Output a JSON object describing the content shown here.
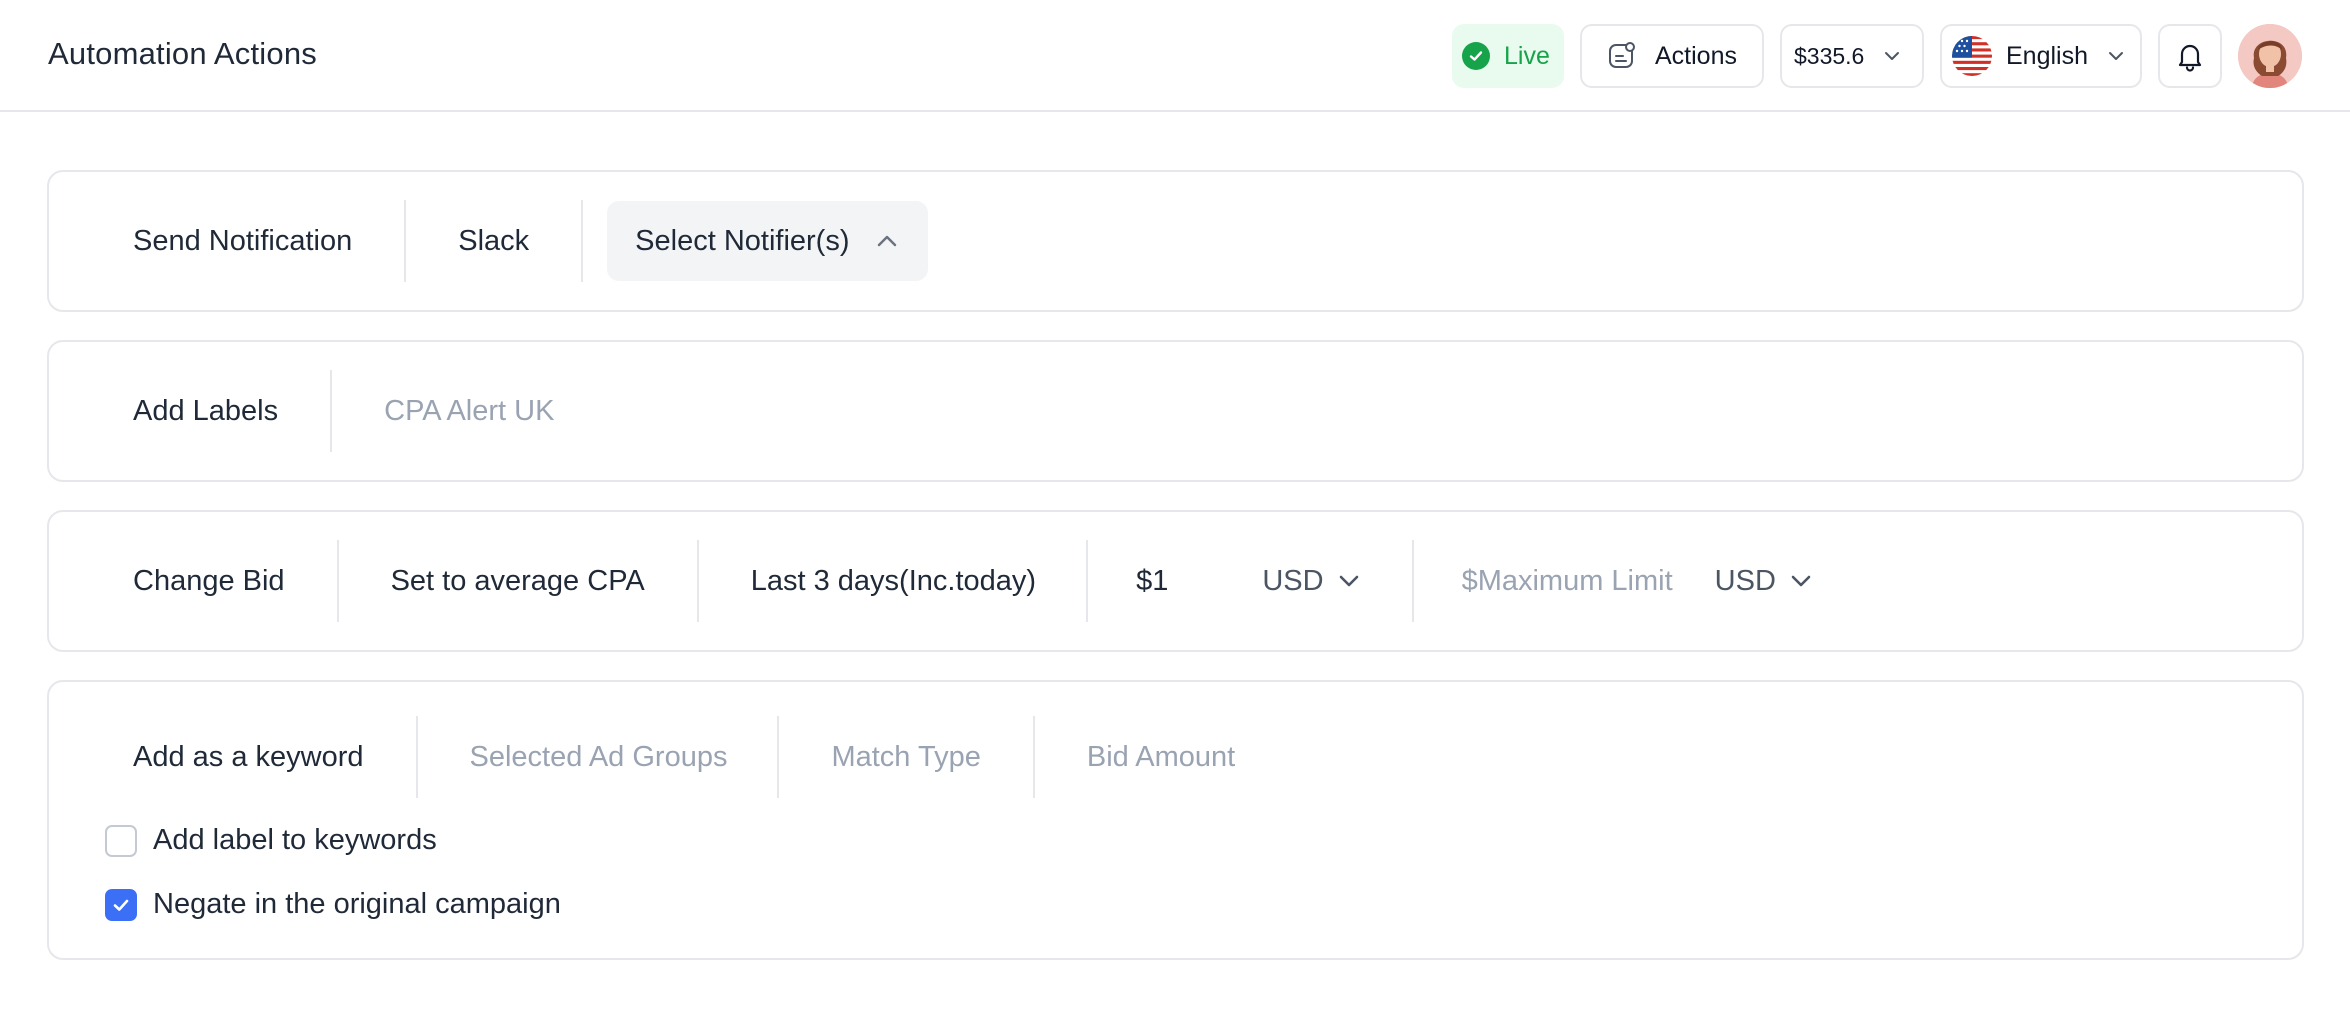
{
  "header": {
    "title": "Automation Actions",
    "live_label": "Live",
    "actions_label": "Actions",
    "balance": "$335.6",
    "language": "English"
  },
  "send_notification": {
    "label": "Send Notification",
    "channel": "Slack",
    "notifier_placeholder": "Select Notifier(s)"
  },
  "add_labels": {
    "label": "Add Labels",
    "value_placeholder": "CPA Alert UK"
  },
  "change_bid": {
    "label": "Change Bid",
    "method": "Set to average CPA",
    "period": "Last 3 days(Inc.today)",
    "amount": "$1",
    "amount_currency": "USD",
    "max_limit_placeholder": "$Maximum Limit",
    "max_limit_currency": "USD"
  },
  "add_keyword": {
    "label": "Add as a keyword",
    "ad_groups_placeholder": "Selected Ad Groups",
    "match_type_placeholder": "Match Type",
    "bid_amount_placeholder": "Bid Amount",
    "options": [
      {
        "label": "Add label to keywords",
        "checked": false
      },
      {
        "label": "Negate in the original campaign",
        "checked": true
      }
    ]
  },
  "colors": {
    "accent": "#3b6ff5",
    "live": "#16a34a",
    "live_bg": "#e9fbef",
    "border": "#e5e7eb",
    "muted_text": "#9aa3b2"
  },
  "icons": {
    "live": "check-circle-icon",
    "actions": "actions-icon",
    "dropdown": "chevron-down-icon",
    "collapse": "chevron-up-icon",
    "language": "us-flag-icon",
    "notifications": "bell-icon"
  }
}
